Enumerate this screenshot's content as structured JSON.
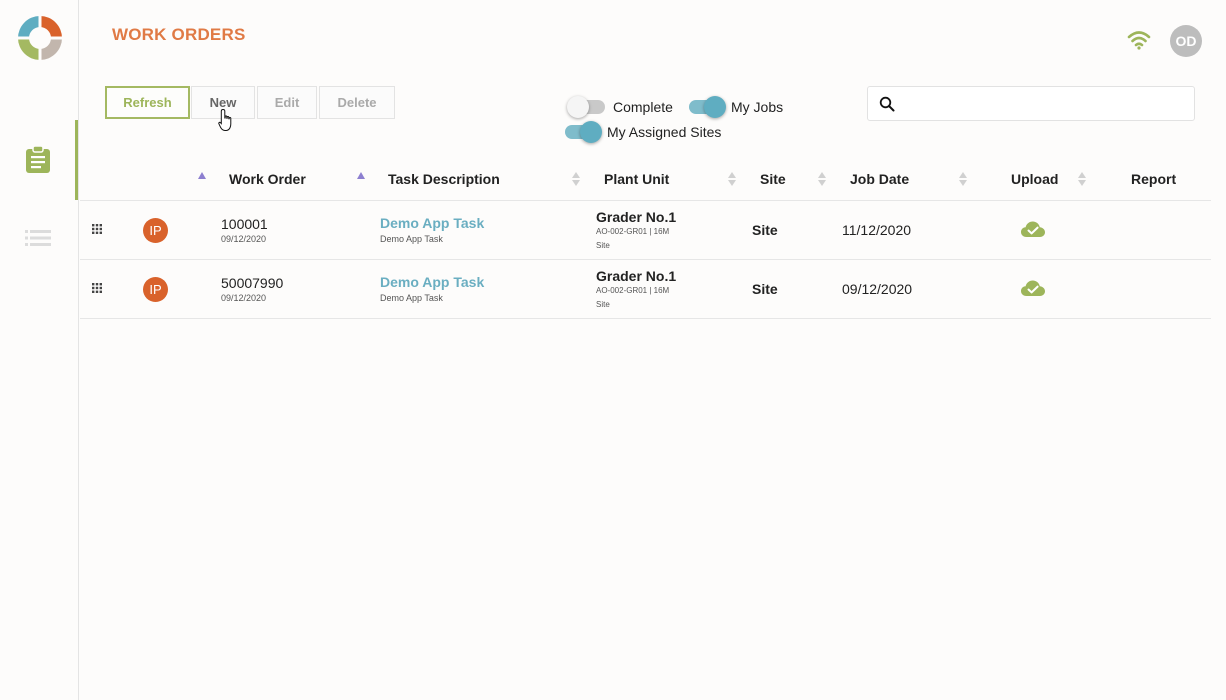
{
  "header": {
    "title": "WORK ORDERS",
    "user_initials": "OD"
  },
  "sidebar": {
    "items": [
      {
        "name": "work-orders",
        "icon": "clipboard-icon",
        "active": true
      },
      {
        "name": "list",
        "icon": "list-icon",
        "active": false
      }
    ]
  },
  "toolbar": {
    "refresh_label": "Refresh",
    "new_label": "New",
    "edit_label": "Edit",
    "delete_label": "Delete"
  },
  "filters": {
    "complete": {
      "label": "Complete",
      "on": false
    },
    "my_jobs": {
      "label": "My Jobs",
      "on": true
    },
    "my_assigned_sites": {
      "label": "My Assigned Sites",
      "on": true
    }
  },
  "search": {
    "placeholder": "",
    "value": ""
  },
  "table": {
    "columns": [
      "Work Order",
      "Task Description",
      "Plant Unit",
      "Site",
      "Job Date",
      "Upload",
      "Report"
    ],
    "rows": [
      {
        "status": "IP",
        "work_order": "100001",
        "work_order_date": "09/12/2020",
        "task_title": "Demo App Task",
        "task_subtitle": "Demo App Task",
        "plant_name": "Grader No.1",
        "plant_code": "AO-002-GR01 | 16M",
        "plant_site": "Site",
        "site": "Site",
        "job_date": "11/12/2020"
      },
      {
        "status": "IP",
        "work_order": "50007990",
        "work_order_date": "09/12/2020",
        "task_title": "Demo App Task",
        "task_subtitle": "Demo App Task",
        "plant_name": "Grader No.1",
        "plant_code": "AO-002-GR01 | 16M",
        "plant_site": "Site",
        "site": "Site",
        "job_date": "09/12/2020"
      }
    ]
  },
  "colors": {
    "accent_orange": "#e07a45",
    "accent_green": "#9db55a",
    "accent_teal": "#5fadc1",
    "status_ip": "#d9622b"
  }
}
